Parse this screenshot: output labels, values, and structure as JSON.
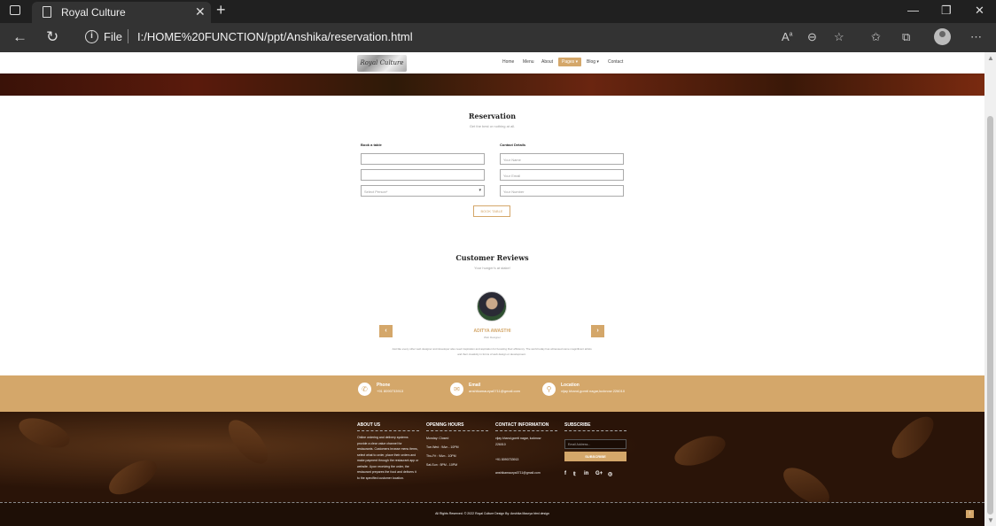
{
  "browser": {
    "tab_title": "Royal Culture",
    "tab_close": "✕",
    "new_tab": "+",
    "address_label": "File",
    "url": "I:/HOME%20FUNCTION/ppt/Anshika/reservation.html",
    "icons": [
      "tab-actions-icon",
      "page-icon",
      "close-icon",
      "plus-icon",
      "minimize-icon",
      "restore-icon",
      "close-window-icon",
      "back-icon",
      "refresh-icon",
      "info-icon",
      "read-aloud-icon",
      "zoom-out-icon",
      "add-favorite-icon",
      "favorites-icon",
      "collections-icon",
      "profile-icon",
      "more-icon"
    ]
  },
  "site": {
    "logo_text": "Royal Culture",
    "nav": [
      "Home",
      "Menu",
      "About",
      "Pages ▾",
      "Blog ▾",
      "Contact"
    ],
    "reservation": {
      "title": "Reservation",
      "subtitle": "Get the best or nothing at all.",
      "book_label": "Book a table",
      "contact_label": "Contact Details",
      "select_placeholder": "Select Person*",
      "name_placeholder": "Your Name",
      "email_placeholder": "Your Email",
      "number_placeholder": "Your Number",
      "button": "BOOK TABLE"
    },
    "reviews": {
      "title": "Customer Reviews",
      "subtitle": "Your hunger's at stake!",
      "name": "ADITYA AWASTHI",
      "role": "Web Designer",
      "text": "Just like every other web designer and developer also need inspiration and aspiration for boosting their efficiency. The world today has witnessed some magnificent artists and their creativity in forms of web design or development.",
      "prev": "‹",
      "next": "›"
    },
    "contact_band": {
      "phone_title": "Phone",
      "phone_value": "+91 8090733913",
      "email_title": "Email",
      "email_value": "anshikamaurya0711@gmail.com",
      "location_title": "Location",
      "location_value": "vijay khand,gomti nagar,lucknow 226010"
    },
    "footer": {
      "about_title": "ABOUT US",
      "about_text": "Online ordering and delivery systems provide a clear value channel for restaurants. Customers browse menu items, select what to order, place their orders and make payment through the restaurant app or website. Upon receiving the order, the restaurant prepares the food and delivers it to the specified customer location.",
      "hours_title": "OPENING HOURS",
      "hours": [
        "Monday: Closed",
        "Tue-Wed : 9Am - 10PM",
        "Thu-Fri : 9Am - 10PM",
        "Sat-Sun : 5PM - 10PM"
      ],
      "contact_title": "CONTACT INFORMATION",
      "contact_address": "vijay khand,gomti nagar, lucknow 226010",
      "contact_phone": "+91 8090733913",
      "contact_email": "anshikamaurya0711@gmail.com",
      "subscribe_title": "SUBSCRIBE",
      "subscribe_placeholder": "Email Address...",
      "subscribe_button": "SUBSCRIBE",
      "social": [
        "f",
        "𝕥",
        "in",
        "G+",
        "◎"
      ],
      "copyright": "All Rights Reserved. © 2022 Royal Culture Design By: Anshika Maurya html design"
    }
  }
}
